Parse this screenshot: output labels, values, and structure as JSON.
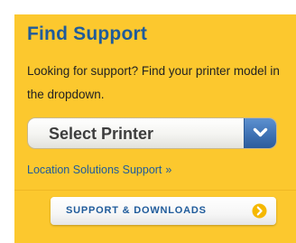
{
  "panel": {
    "title": "Find Support",
    "description": "Looking for support? Find your printer model in the dropdown.",
    "background_color": "#fcc82e"
  },
  "printer_select": {
    "selected_value": "Select Printer",
    "icon": "chevron-down-icon",
    "accent_color": "#3f72b4"
  },
  "location_link": {
    "label": "Location Solutions Support",
    "arrow": "»"
  },
  "support_button": {
    "label": "SUPPORT & DOWNLOADS",
    "icon": "arrow-circle-right-icon",
    "icon_color": "#f5b800"
  }
}
